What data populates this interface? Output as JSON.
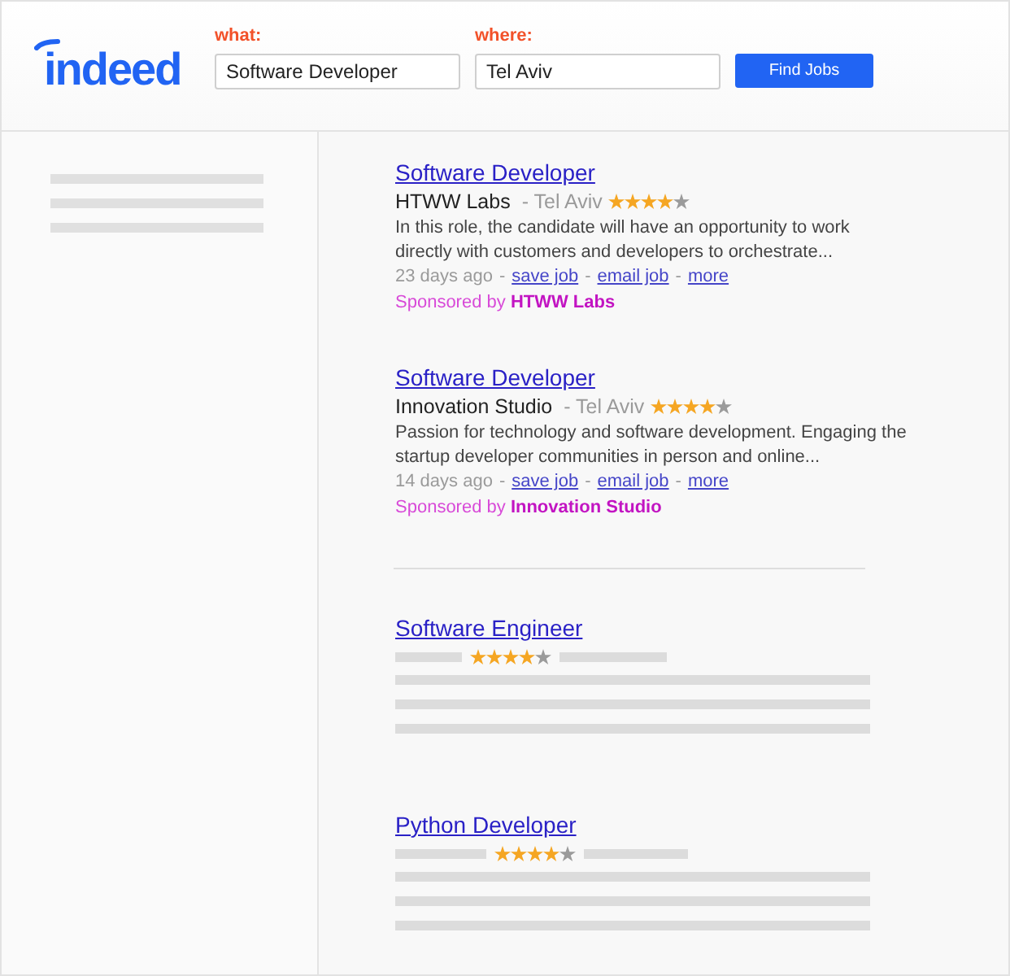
{
  "header": {
    "logo": "indeed",
    "fields": [
      {
        "label": "what:",
        "value": "Software Developer"
      },
      {
        "label": "where:",
        "value": "Tel Aviv"
      }
    ],
    "button": "Find Jobs"
  },
  "jobs": [
    {
      "kind": "full",
      "title": "Software Developer",
      "company": "HTWW Labs",
      "location": "- Tel Aviv",
      "stars": 4,
      "description": "In this role, the candidate will have an opportunity to work directly with customers and developers to orchestrate...",
      "age": "23 days ago",
      "links": [
        {
          "separator": "-",
          "label": "save job"
        },
        {
          "separator": "-",
          "label": "email job"
        },
        {
          "separator": "-",
          "label": "more"
        }
      ],
      "sponsored": "Sponsored by **HTWW Labs**"
    },
    {
      "kind": "full",
      "title": "Software Developer",
      "company": "Innovation Studio",
      "location": "- Tel Aviv",
      "stars": 4,
      "description": "Passion for technology and software development. Engaging the startup developer communities in person and online...",
      "age": "14 days ago",
      "links": [
        {
          "separator": "-",
          "label": "save job"
        },
        {
          "separator": "-",
          "label": "email job"
        },
        {
          "separator": "-",
          "label": "more"
        }
      ],
      "sponsored": "Sponsored by **Innovation Studio**"
    },
    {
      "kind": "placeholder",
      "title": "Software Engineer",
      "stars": 4
    },
    {
      "kind": "placeholder",
      "title": "Python Developer",
      "stars": 4
    }
  ]
}
